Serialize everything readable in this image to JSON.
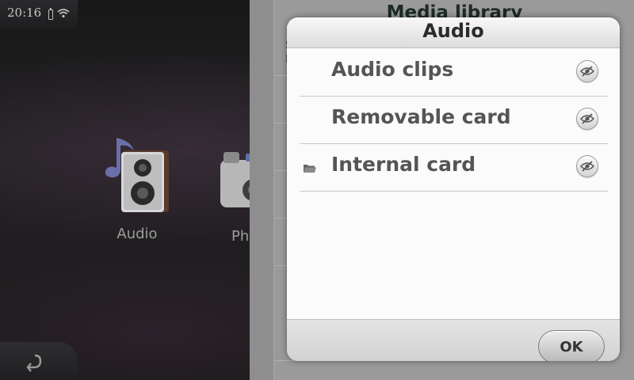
{
  "status_bar": {
    "time": "20:16"
  },
  "desktop": {
    "apps": [
      {
        "label": "Audio",
        "icon": "speaker-icon"
      },
      {
        "label": "Ph",
        "icon": "camera-icon"
      }
    ]
  },
  "media_library": {
    "title": "Media library",
    "peek_text": [
      "S",
      "I"
    ]
  },
  "dialog": {
    "title": "Audio",
    "items": [
      {
        "label": "Audio clips",
        "selected": false
      },
      {
        "label": "Removable card",
        "selected": false
      },
      {
        "label": "Internal card",
        "selected": true
      }
    ],
    "ok_label": "OK"
  },
  "colors": {
    "dialog_background": "#f3f3f3",
    "title_text": "#2b2b2b",
    "item_text": "#555555"
  }
}
